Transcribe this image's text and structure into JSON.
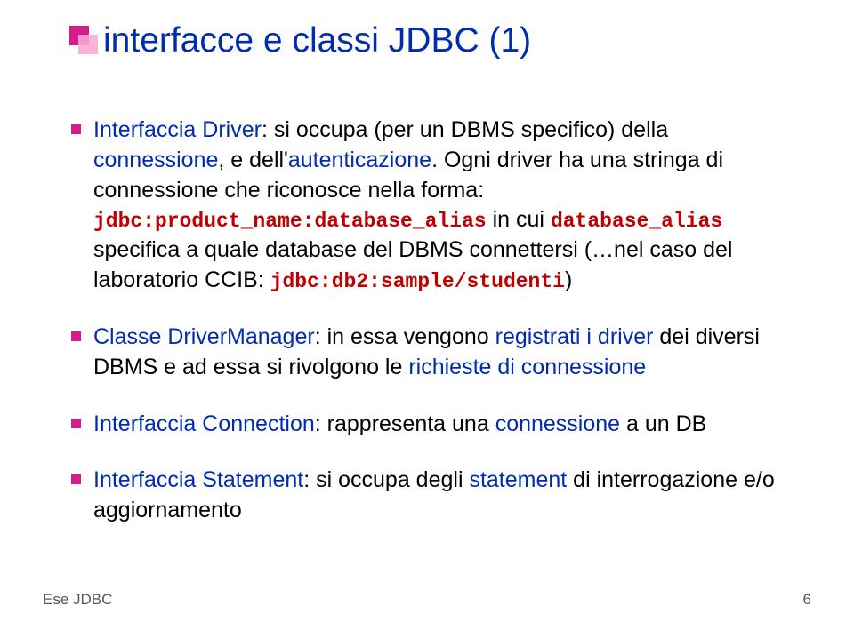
{
  "title": "interfacce e classi JDBC (1)",
  "bullets": [
    {
      "segments": [
        {
          "t": "Interfaccia Driver",
          "cls": "link"
        },
        {
          "t": ": si occupa (per un DBMS specifico) della "
        },
        {
          "t": "connessione",
          "cls": "link"
        },
        {
          "t": ", e dell'"
        },
        {
          "t": "autenticazione",
          "cls": "link"
        },
        {
          "t": ". Ogni driver ha una stringa di connessione che riconosce nella forma: "
        },
        {
          "t": "jdbc:product_name:database_alias",
          "cls": "mono"
        },
        {
          "t": " in cui "
        },
        {
          "t": "database_alias",
          "cls": "mono"
        },
        {
          "t": " specifica a quale database del DBMS connettersi (…nel caso del laboratorio CCIB: "
        },
        {
          "t": "jdbc:db2:sample/studenti",
          "cls": "mono"
        },
        {
          "t": ")"
        }
      ]
    },
    {
      "segments": [
        {
          "t": "Classe DriverManager",
          "cls": "link"
        },
        {
          "t": ": in essa vengono "
        },
        {
          "t": "registrati i driver",
          "cls": "link"
        },
        {
          "t": " dei diversi DBMS e ad essa si rivolgono le "
        },
        {
          "t": "richieste di connessione",
          "cls": "link"
        }
      ]
    },
    {
      "segments": [
        {
          "t": "Interfaccia Connection",
          "cls": "link"
        },
        {
          "t": ": rappresenta una "
        },
        {
          "t": "connessione",
          "cls": "link"
        },
        {
          "t": " a un DB"
        }
      ]
    },
    {
      "segments": [
        {
          "t": "Interfaccia Statement",
          "cls": "link"
        },
        {
          "t": ": si occupa degli "
        },
        {
          "t": "statement",
          "cls": "link"
        },
        {
          "t": " di interrogazione e/o aggiornamento"
        }
      ]
    }
  ],
  "footer": {
    "left": "Ese JDBC",
    "right": "6"
  }
}
